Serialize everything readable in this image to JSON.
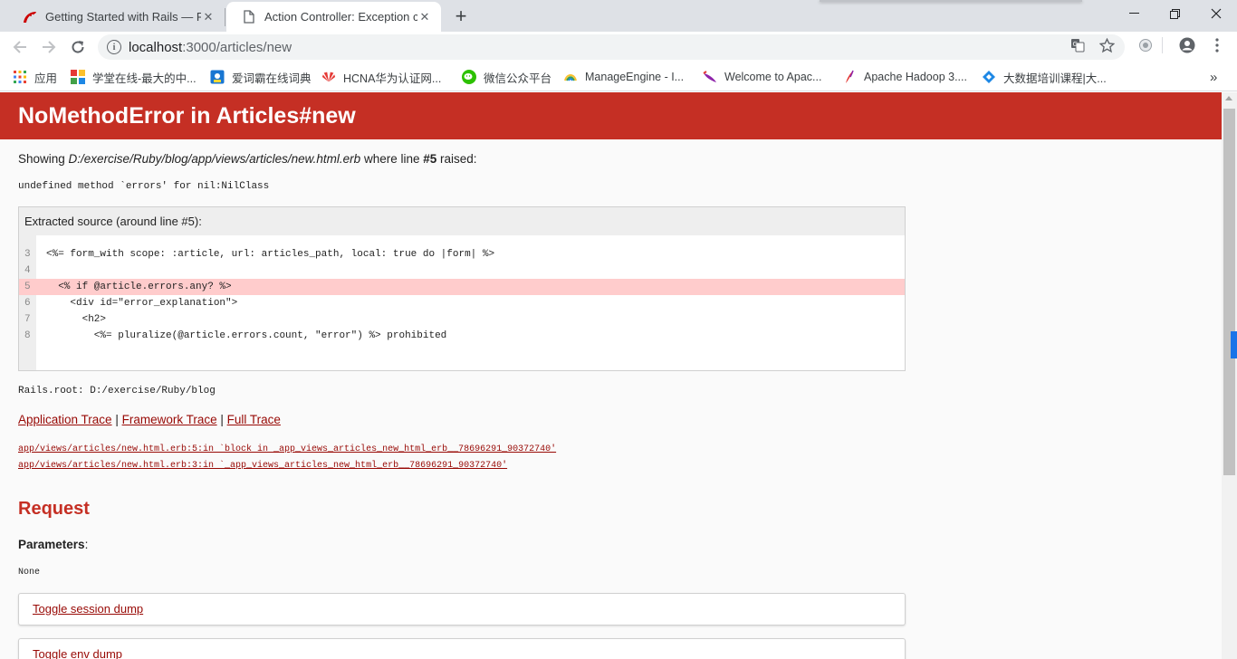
{
  "browser": {
    "tabs": [
      {
        "title": "Getting Started with Rails — Ruby on Rails Guides",
        "active": false
      },
      {
        "title": "Action Controller: Exception caught",
        "active": true
      }
    ],
    "address": {
      "host": "localhost",
      "rest": ":3000/articles/new"
    },
    "bookmarks": [
      {
        "label": "应用",
        "icon": "apps-grid-icon"
      },
      {
        "label": "学堂在线-最大的中...",
        "icon": "xuetang-icon"
      },
      {
        "label": "爱词霸在线词典",
        "icon": "iciba-icon"
      },
      {
        "label": "HCNA华为认证网...",
        "icon": "huawei-icon"
      },
      {
        "label": "微信公众平台",
        "icon": "wechat-icon"
      },
      {
        "label": "ManageEngine - I...",
        "icon": "manageengine-icon"
      },
      {
        "label": "Welcome to Apac...",
        "icon": "apache-feather-icon"
      },
      {
        "label": "Apache Hadoop 3....",
        "icon": "apache-feather-icon"
      },
      {
        "label": "大数据培训课程|大...",
        "icon": "bigdata-icon"
      }
    ]
  },
  "error": {
    "title": "NoMethodError in Articles#new",
    "showing_prefix": "Showing ",
    "template_path": "D:/exercise/Ruby/blog/app/views/articles/new.html.erb",
    "showing_mid": " where line ",
    "line_ref": "#5",
    "showing_suffix": " raised:",
    "message": "undefined method `errors' for nil:NilClass"
  },
  "source": {
    "header": "Extracted source (around line #5):",
    "lines": [
      {
        "num": "3",
        "code": "<%= form_with scope: :article, url: articles_path, local: true do |form| %>",
        "highlight": false
      },
      {
        "num": "4",
        "code": "",
        "highlight": false
      },
      {
        "num": "5",
        "code": "  <% if @article.errors.any? %>",
        "highlight": true
      },
      {
        "num": "6",
        "code": "    <div id=\"error_explanation\">",
        "highlight": false
      },
      {
        "num": "7",
        "code": "      <h2>",
        "highlight": false
      },
      {
        "num": "8",
        "code": "        <%= pluralize(@article.errors.count, \"error\") %> prohibited",
        "highlight": false
      }
    ]
  },
  "rails_root": "Rails.root: D:/exercise/Ruby/blog",
  "traces": {
    "links": [
      "Application Trace",
      "Framework Trace",
      "Full Trace"
    ],
    "separator": " | ",
    "entries": [
      "app/views/articles/new.html.erb:5:in `block in _app_views_articles_new_html_erb__78696291_90372740'",
      "app/views/articles/new.html.erb:3:in `_app_views_articles_new_html_erb__78696291_90372740'"
    ]
  },
  "request": {
    "heading": "Request",
    "params_label": "Parameters",
    "params_colon": ":",
    "params_value": "None",
    "toggles": [
      "Toggle session dump",
      "Toggle env dump"
    ]
  },
  "colors": {
    "header_red": "#c52f24",
    "link_red": "#980905",
    "highlight_row": "#ffcccc"
  }
}
